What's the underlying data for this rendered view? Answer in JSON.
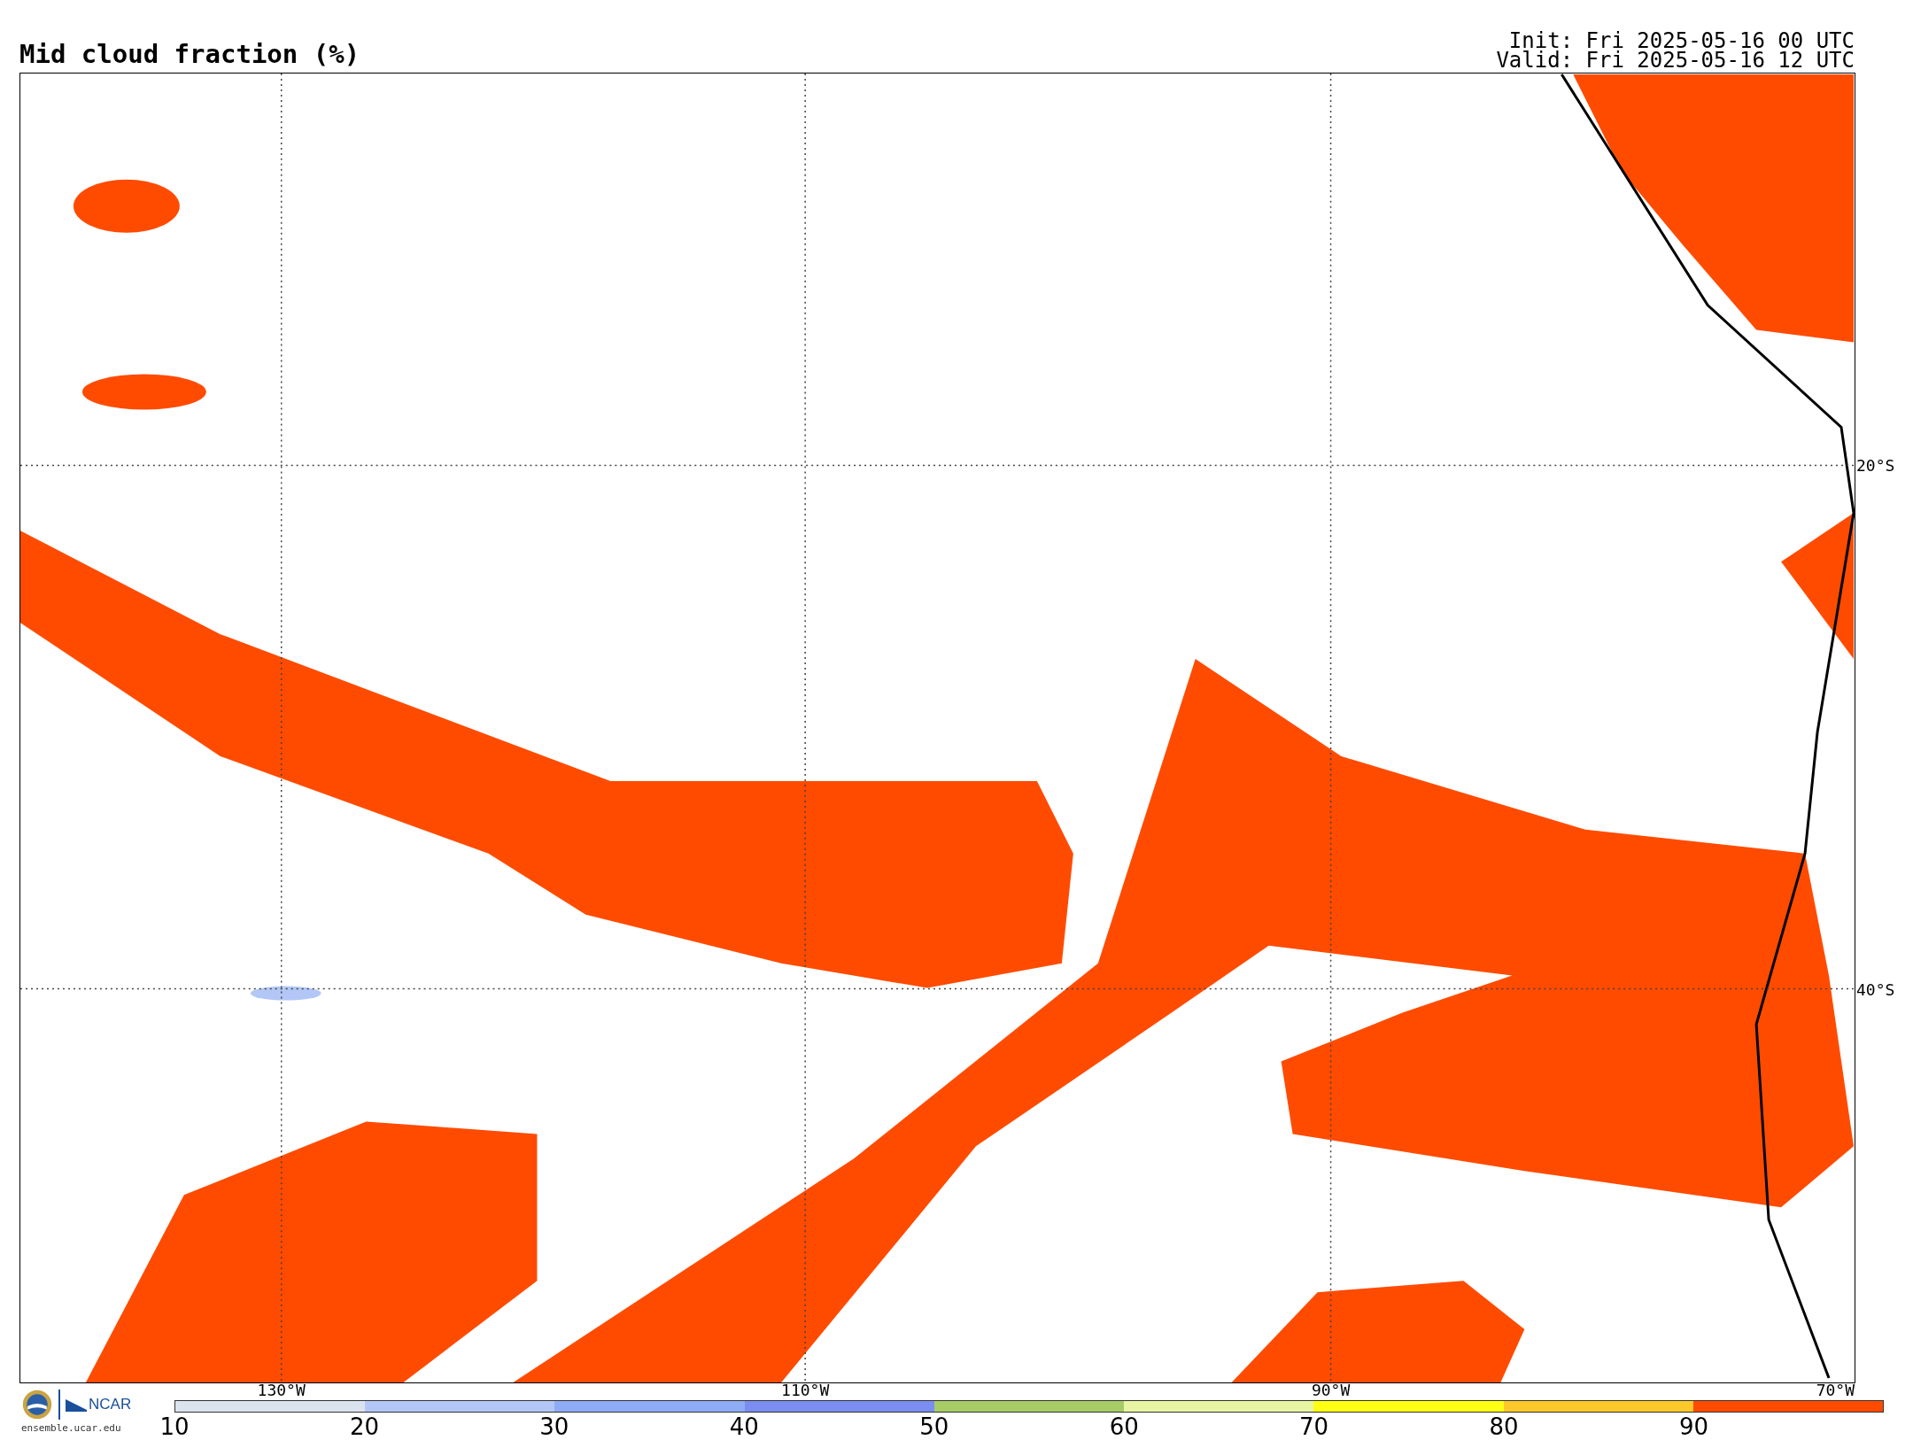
{
  "title": "Mid cloud fraction (%)",
  "times": [
    "Init: Fri 2025-05-16 00 UTC",
    "Valid: Fri 2025-05-16 12 UTC"
  ],
  "map": {
    "lat_labels": [
      "20°S",
      "40°S"
    ],
    "lon_labels": [
      "130°W",
      "110°W",
      "90°W",
      "70°W"
    ]
  },
  "logo": {
    "text": "NCAR",
    "caption": "ensemble.ucar.edu"
  },
  "colorbar": {
    "segments": [
      {
        "color": "#dbe4ee"
      },
      {
        "color": "#b3c7f7"
      },
      {
        "color": "#8eacf6"
      },
      {
        "color": "#7b8df0"
      },
      {
        "color": "#a7cc66"
      },
      {
        "color": "#e8f5a3"
      },
      {
        "color": "#ffff14"
      },
      {
        "color": "#fdc92a"
      },
      {
        "color": "#ff4b00"
      }
    ],
    "ticks": [
      "10",
      "20",
      "30",
      "40",
      "50",
      "60",
      "70",
      "80",
      "90"
    ]
  }
}
